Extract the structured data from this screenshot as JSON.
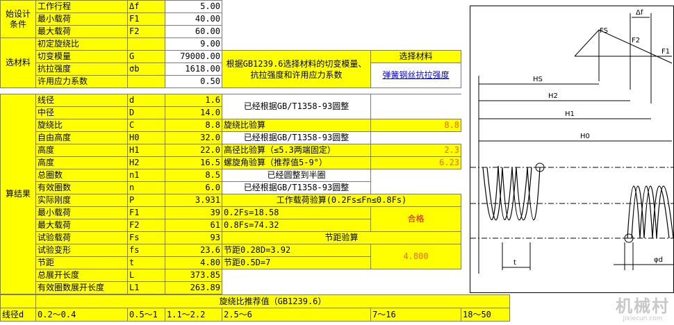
{
  "sections": {
    "initial": "始设计条件",
    "material": "选材料",
    "results": "算结果"
  },
  "rows": [
    {
      "label": "工作行程",
      "sym": "Δf",
      "val": "5.00"
    },
    {
      "label": "最小载荷",
      "sym": "F1",
      "val": "40.00"
    },
    {
      "label": "最大载荷",
      "sym": "F2",
      "val": "60.00"
    },
    {
      "label": "初定旋绕比",
      "sym": "",
      "val": "9.00"
    },
    {
      "label": "切变模量",
      "sym": "G",
      "val": "79000.00"
    },
    {
      "label": "抗拉强度",
      "sym": "σb",
      "val": "1618.00"
    },
    {
      "label": "许用应力系数",
      "sym": "",
      "val": "0.50"
    }
  ],
  "material_note": "根据GB1239.6选择材料的切变模量、抗拉强度和许用应力系数",
  "select_material": {
    "title": "选择材料",
    "link": "弹簧钢丝抗拉强度"
  },
  "results": [
    {
      "label": "线径",
      "sym": "d",
      "val": "1.6"
    },
    {
      "label": "中径",
      "sym": "D",
      "val": "14.0"
    },
    {
      "label": "旋绕比",
      "sym": "C",
      "val": "8.8"
    },
    {
      "label": "自由高度",
      "sym": "H0",
      "val": "32.0"
    },
    {
      "label": "高度",
      "sym": "H1",
      "val": "22.0"
    },
    {
      "label": "高度",
      "sym": "H2",
      "val": "16.5"
    },
    {
      "label": "总圈数",
      "sym": "n1",
      "val": "8.5"
    },
    {
      "label": "有效圈数",
      "sym": "n",
      "val": "6.0"
    },
    {
      "label": "实际刚度",
      "sym": "P",
      "val": "3.931"
    },
    {
      "label": "最小载荷",
      "sym": "F1",
      "val": "39"
    },
    {
      "label": "最大载荷",
      "sym": "F2",
      "val": "61"
    },
    {
      "label": "试验载荷",
      "sym": "Fs",
      "val": "93"
    },
    {
      "label": "试验变形",
      "sym": "fs",
      "val": "23.6"
    },
    {
      "label": "节距",
      "sym": "t",
      "val": "4.80"
    },
    {
      "label": "总展开长度",
      "sym": "L",
      "val": "373.85"
    },
    {
      "label": "有效圈数展开长度",
      "sym": "L1",
      "val": "263.89"
    }
  ],
  "checks": {
    "rounded_d": "已经根据GB/T1358-93圆整",
    "index_check": "旋绕比验算",
    "index_val": "8.8",
    "rounded_h0": "已经根据GB/T1358-93圆整",
    "slender_check": "高径比验算（≤5.3两端固定）",
    "slender_val": "2.3",
    "helix_check": "螺旋角验算（推荐值5-9°）",
    "helix_val": "6.23",
    "rounded_half": "已经圆整到半圈",
    "rounded_n": "已经根据GB/T1358-93圆整",
    "load_check": "工作载荷验算(0.2Fs≤Fn≤0.8Fs)",
    "load_min": "0.2Fs=18.58",
    "load_max": "0.8Fs=74.32",
    "load_result": "合格",
    "pitch_check": "节距验算",
    "pitch_min": "节距0.28D=3.92",
    "pitch_max": "节距0.5D=7",
    "pitch_val": "4.800"
  },
  "footer": {
    "title": "旋绕比推荐值（GB1239.6）",
    "row_label": "线径d",
    "cols": [
      "0.2～0.4",
      "0.5～1",
      "1.1～2.2",
      "2.5～6",
      "7～16",
      "18～50"
    ]
  },
  "diagram": {
    "labels": {
      "fs": "FS",
      "f2": "F2",
      "f1": "F1",
      "df": "Δf",
      "hs": "HS",
      "h2": "H2",
      "h1": "H1",
      "h0": "H0",
      "t": "t",
      "phid": "φd"
    }
  },
  "watermark": {
    "main": "机械村",
    "sub": "Jixiecun.com"
  }
}
